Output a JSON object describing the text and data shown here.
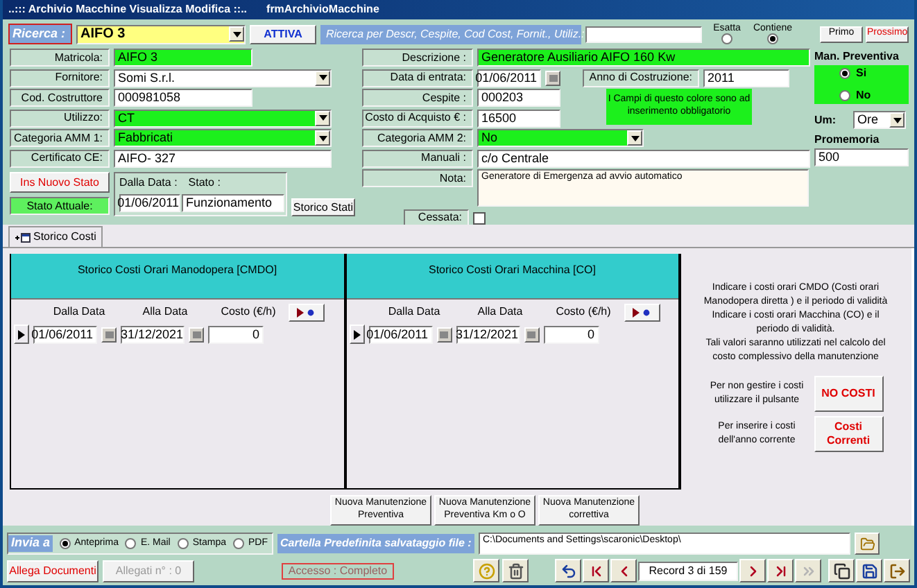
{
  "window": {
    "title": "..::: Archivio Macchine Visualizza Modifica ::..",
    "form_name": "frmArchivioMacchine"
  },
  "search": {
    "label": "Ricerca :",
    "value": "AIFO 3",
    "activate_button": "ATTIVA",
    "hint": "Ricerca per Descr, Cespite, Cod Cost, Fornit., Utiliz.:",
    "modes": [
      {
        "label": "Esatta",
        "selected": false
      },
      {
        "label": "Contiene",
        "selected": true
      }
    ],
    "buttons": [
      {
        "label": "Primo",
        "alert": false
      },
      {
        "label": "Prossimo",
        "alert": true
      }
    ]
  },
  "left_fields": [
    {
      "label": "Matricola:",
      "value": "AIFO 3",
      "kind": "text",
      "required": true
    },
    {
      "label": "Fornitore:",
      "value": "Somi S.r.l.",
      "kind": "combo",
      "required": false
    },
    {
      "label": "Cod. Costruttore",
      "value": "000981058",
      "kind": "short",
      "required": false
    },
    {
      "label": "Utilizzo:",
      "value": "CT",
      "kind": "combo",
      "required": true
    },
    {
      "label": "Categoria AMM 1:",
      "value": "Fabbricati",
      "kind": "combo",
      "required": true
    },
    {
      "label": "Certificato CE:",
      "value": "AIFO- 327",
      "kind": "text",
      "required": false
    }
  ],
  "descrizione": {
    "label": "Descrizione :",
    "value": "Generatore Ausiliario AIFO  160 Kw",
    "required": true
  },
  "data_entrata": {
    "label": "Data di entrata:",
    "value": "01/06/2011"
  },
  "anno_costruzione": {
    "label": "Anno di Costruzione:",
    "value": "2011"
  },
  "cespite": {
    "label": "Cespite :",
    "value": "000203"
  },
  "costo_acquisto": {
    "label": "Costo di Acquisto € :",
    "value": "16500"
  },
  "required_note": "I Campi di questo colore sono ad inserimento obbligatorio",
  "categoria_amm2": {
    "label": "Categoria AMM 2:",
    "value": "No",
    "required": true
  },
  "manuali": {
    "label": "Manuali :",
    "value": "c/o  Centrale"
  },
  "nota": {
    "label": "Nota:",
    "value": "Generatore di Emergenza  ad avvio automatico"
  },
  "cessata": {
    "label": "Cessata:",
    "checked": false
  },
  "man_preventiva": {
    "title": "Man. Preventiva",
    "options": [
      {
        "label": "Si",
        "selected": true
      },
      {
        "label": "No",
        "selected": false
      }
    ]
  },
  "um": {
    "label": "Um:",
    "value": "Ore"
  },
  "promemoria": {
    "label": "Promemoria",
    "value": "500"
  },
  "stato": {
    "new_button": "Ins Nuovo Stato",
    "current_label": "Stato Attuale:",
    "date_label": "Dalla Data :",
    "state_label": "Stato :",
    "date": "01/06/2011",
    "state": "Funzionamento",
    "history_button": "Storico Stati"
  },
  "tabs": [
    {
      "label": "Storico Costi",
      "selected": true
    }
  ],
  "cost_tables": [
    {
      "title": "Storico Costi Orari Manodopera [CMDO]",
      "columns": [
        "Dalla Data",
        "Alla Data",
        "Costo (€/h)"
      ],
      "rows": [
        {
          "from": "01/06/2011",
          "to": "31/12/2021",
          "cost": "0"
        }
      ]
    },
    {
      "title": "Storico Costi Orari Macchina [CO]",
      "columns": [
        "Dalla Data",
        "Alla Data",
        "Costo (€/h)"
      ],
      "rows": [
        {
          "from": "01/06/2011",
          "to": "31/12/2021",
          "cost": "0"
        }
      ]
    }
  ],
  "info_text": [
    "Indicare i costi orari CMDO (Costi orari Manodopera diretta ) e il periodo di validità",
    "Indicare i costi orari Macchina (CO) e il periodo di validità.",
    "Tali  valori saranno utilizzati nel calcolo del costo complessivo della manutenzione"
  ],
  "cost_actions": [
    {
      "text": "Per non gestire i costi utilizzare il pulsante",
      "button": "NO COSTI"
    },
    {
      "text": "Per inserire i costi dell'anno corrente",
      "button": "Costi Correnti"
    }
  ],
  "maintenance_buttons": [
    "Nuova Manutenzione Preventiva",
    "Nuova Manutenzione Preventiva Km o O",
    "Nuova Manutenzione correttiva"
  ],
  "bottom": {
    "send_label": "Invia a",
    "send_options": [
      {
        "label": "Anteprima",
        "selected": true
      },
      {
        "label": "E. Mail",
        "selected": false
      },
      {
        "label": "Stampa",
        "selected": false
      },
      {
        "label": "PDF",
        "selected": false
      }
    ],
    "folder_label": "Cartella Predefinita salvataggio file :",
    "folder_path": "C:\\Documents and Settings\\scaronic\\Desktop\\",
    "attach_button": "Allega Documenti",
    "attachments": {
      "label": "Allegati n° : 0",
      "disabled": true
    },
    "access": {
      "label": "Accesso : Completo",
      "disabled": true
    },
    "tools": [
      {
        "kind": "help"
      },
      {
        "kind": "delete"
      }
    ],
    "nav_left": [
      {
        "kind": "undo",
        "disabled": false
      },
      {
        "kind": "first",
        "disabled": false
      },
      {
        "kind": "prev",
        "disabled": false
      }
    ],
    "record": "Record 3 di 159",
    "nav_right": [
      {
        "kind": "next",
        "disabled": false
      },
      {
        "kind": "last",
        "disabled": false
      },
      {
        "kind": "new",
        "disabled": true
      }
    ],
    "extra": [
      {
        "kind": "duplicate"
      },
      {
        "kind": "save"
      },
      {
        "kind": "exit"
      }
    ]
  }
}
